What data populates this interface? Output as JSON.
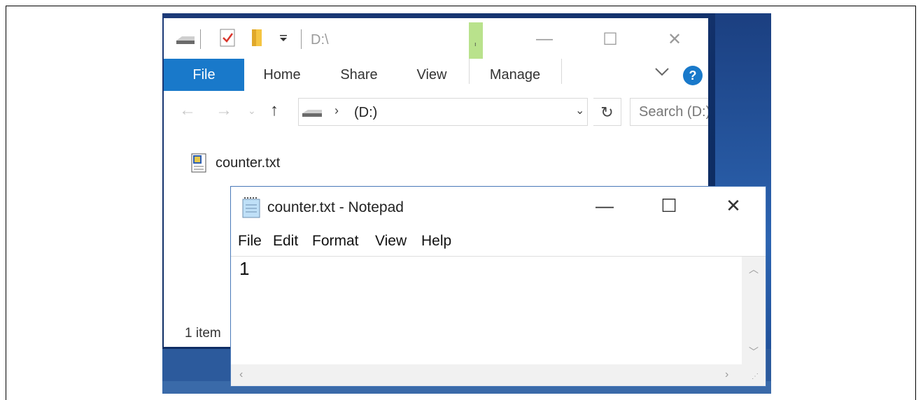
{
  "explorer": {
    "title_path": "D:\\",
    "ribbon_tabs": [
      "File",
      "Home",
      "Share",
      "View",
      "Manage"
    ],
    "help_label": "?",
    "address": "(D:)",
    "search_placeholder": "Search (D:)",
    "file_name": "counter.txt",
    "status_text": "1 item",
    "icons": {
      "drive": "drive-icon",
      "properties": "properties-icon",
      "new_folder": "folder-icon",
      "customize": "chevron-down-icon",
      "back": "back-arrow-icon",
      "forward": "forward-arrow-icon",
      "recent": "recent-locations-icon",
      "up": "up-arrow-icon",
      "refresh": "refresh-icon"
    }
  },
  "notepad": {
    "title": "counter.txt - Notepad",
    "menu": [
      "File",
      "Edit",
      "Format",
      "View",
      "Help"
    ],
    "content": "1"
  },
  "colors": {
    "accent": "#1979ca",
    "notepad_border": "#4a79b8",
    "manage_tab_green": "#b9e28c"
  }
}
